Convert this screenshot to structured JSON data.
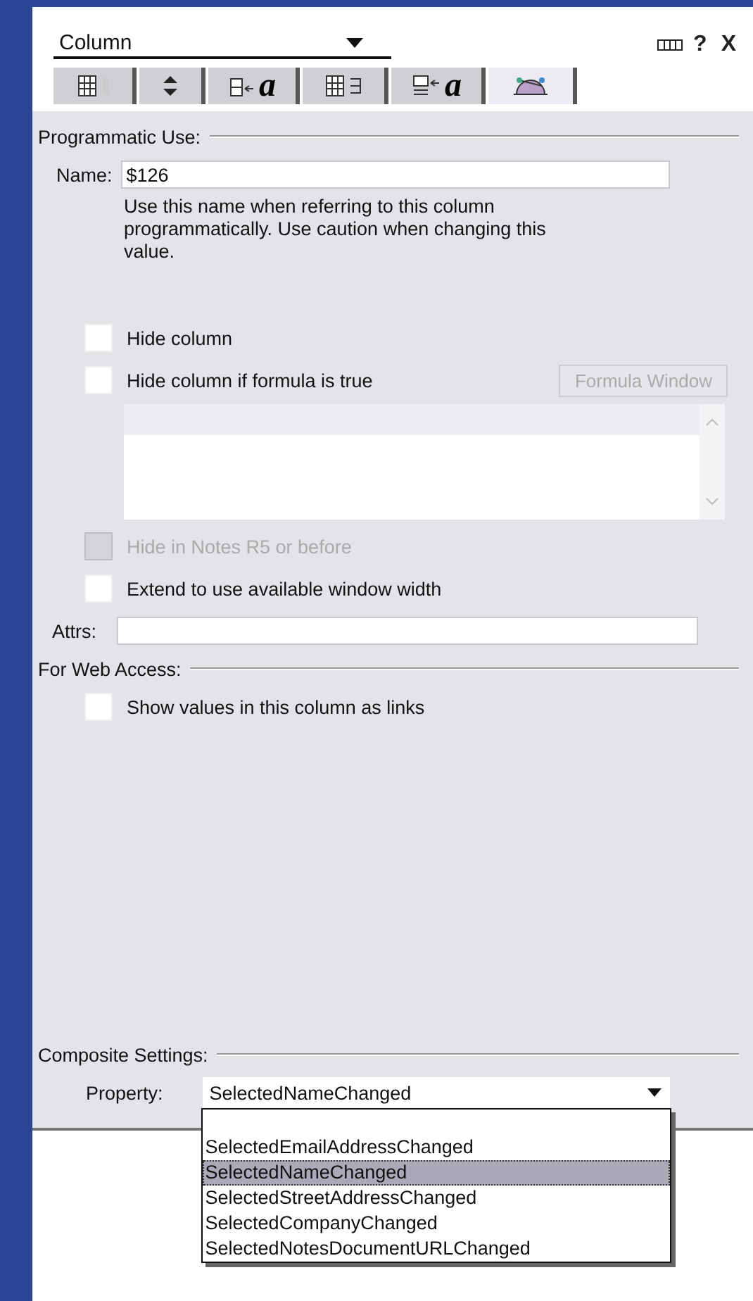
{
  "window": {
    "title": "Column",
    "controls": [
      "?",
      "X"
    ]
  },
  "tabs": [
    {
      "kind": "info",
      "selected": false
    },
    {
      "kind": "sort",
      "selected": false
    },
    {
      "kind": "font",
      "glyphs": [
        "a"
      ],
      "selected": false
    },
    {
      "kind": "numbers",
      "selected": false
    },
    {
      "kind": "title",
      "glyphs": [
        "a"
      ],
      "selected": false
    },
    {
      "kind": "advanced",
      "selected": true
    }
  ],
  "sections": [
    {
      "title": "Programmatic Use:",
      "items": [
        {
          "kind": "field",
          "label": "Name:",
          "value": "$126"
        },
        {
          "kind": "note",
          "text": "Use this name when referring to this column programmatically.  Use caution when changing this value."
        },
        {
          "kind": "checkbox",
          "label": "Hide column",
          "checked": false,
          "disabled": false
        },
        {
          "kind": "checkbox",
          "label": "Hide column if formula is true",
          "checked": false,
          "disabled": false,
          "button": "Formula Window"
        },
        {
          "kind": "formula"
        },
        {
          "kind": "checkbox",
          "label": "Hide in Notes R5 or before",
          "checked": false,
          "disabled": true
        },
        {
          "kind": "checkbox",
          "label": "Extend to use available window width",
          "checked": false,
          "disabled": false
        },
        {
          "kind": "attrs",
          "label": "Attrs:",
          "value": ""
        }
      ]
    },
    {
      "title": "For Web Access:",
      "items": [
        {
          "kind": "checkbox",
          "label": "Show values in this column as links",
          "checked": false,
          "disabled": false
        }
      ]
    },
    {
      "title": "Composite Settings:",
      "items": [
        {
          "kind": "select",
          "label": "Property:",
          "value": "SelectedNameChanged",
          "options": [
            {
              "label": "SelectedEmailAddressChanged",
              "selected": false
            },
            {
              "label": "SelectedNameChanged",
              "selected": true
            },
            {
              "label": "SelectedStreetAddressChanged",
              "selected": false
            },
            {
              "label": "SelectedCompanyChanged",
              "selected": false
            },
            {
              "label": "SelectedNotesDocumentURLChanged",
              "selected": false
            }
          ]
        }
      ]
    }
  ]
}
